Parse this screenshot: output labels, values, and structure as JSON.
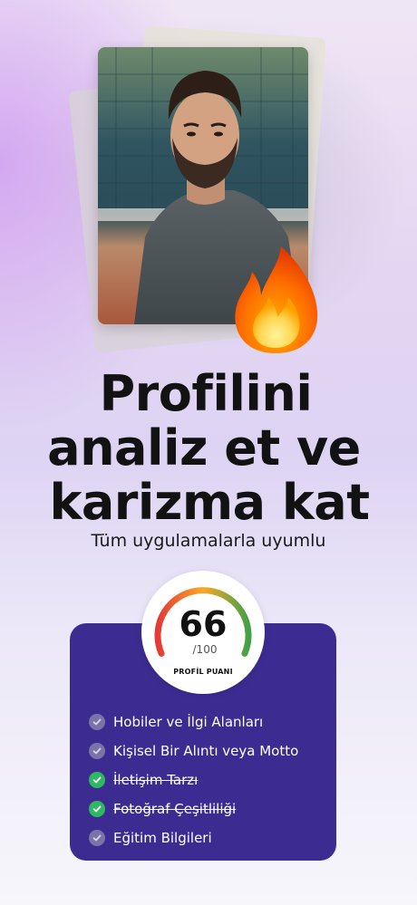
{
  "hero": {
    "headline_lines": [
      "Profilini",
      "analiz et ve",
      "karizma kat"
    ],
    "subtitle": "Tüm uygulamalarla uyumlu"
  },
  "score": {
    "value": "66",
    "max": "/100",
    "label": "PROFİL PUANI",
    "fraction": 0.66
  },
  "features": [
    {
      "label": "Hobiler ve İlgi Alanları",
      "completed": false
    },
    {
      "label": "Kişisel Bir Alıntı veya Motto",
      "completed": false
    },
    {
      "label": "İletişim Tarzı",
      "completed": true
    },
    {
      "label": "Fotoğraf Çeşitliliği",
      "completed": true
    },
    {
      "label": "Eğitim Bilgileri",
      "completed": false
    }
  ],
  "colors": {
    "panel": "#3c2c92",
    "check_done": "#2eb863",
    "check_pending": "#7a74a6",
    "gauge_start": "#e53935",
    "gauge_mid": "#f9a825",
    "gauge_end": "#43a047"
  },
  "icons": {
    "fire": "fire-emoji-icon",
    "check": "checkmark-icon"
  }
}
